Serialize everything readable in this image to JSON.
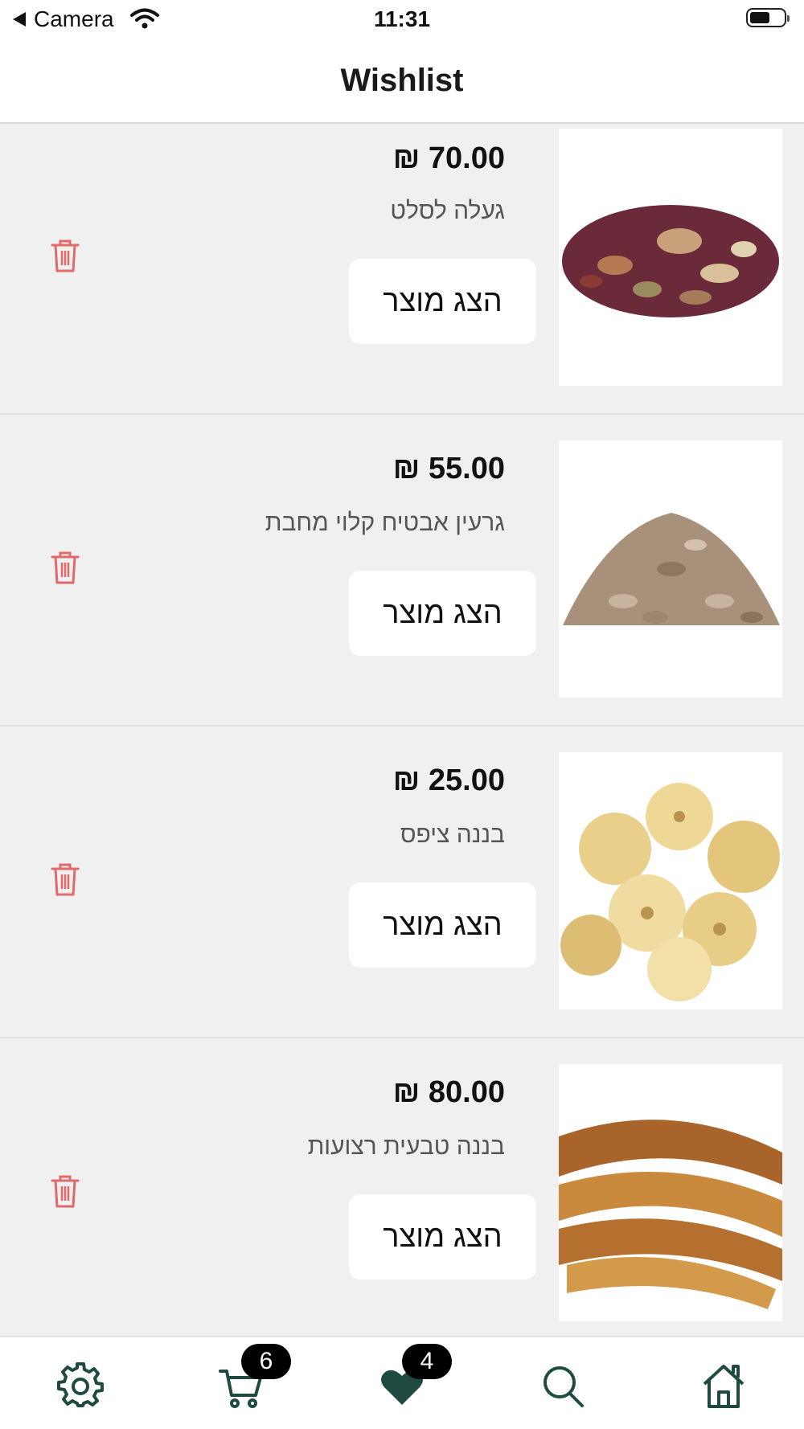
{
  "status_bar": {
    "back_app": "Camera",
    "time": "11:31"
  },
  "nav": {
    "title": "Wishlist"
  },
  "items": [
    {
      "price": "₪ 70.00",
      "name": "געלה לסלט",
      "button": "הצג מוצר",
      "image": "trail-mix-image"
    },
    {
      "price": "₪ 55.00",
      "name": "גרעין אבטיח קלוי מחבת",
      "button": "הצג מוצר",
      "image": "watermelon-seeds-image"
    },
    {
      "price": "₪ 25.00",
      "name": "בננה ציפס",
      "button": "הצג מוצר",
      "image": "banana-chips-image"
    },
    {
      "price": "₪ 80.00",
      "name": "בננה טבעית רצועות",
      "button": "הצג מוצר",
      "image": "dried-banana-strips-image"
    }
  ],
  "tabs": [
    {
      "icon": "gear-icon"
    },
    {
      "icon": "cart-icon",
      "badge": "6"
    },
    {
      "icon": "heart-icon",
      "badge": "4"
    },
    {
      "icon": "search-icon"
    },
    {
      "icon": "home-icon"
    }
  ],
  "colors": {
    "accent": "#1f4a42",
    "trash": "#e06a6a",
    "list_bg": "#f0f0f1"
  }
}
